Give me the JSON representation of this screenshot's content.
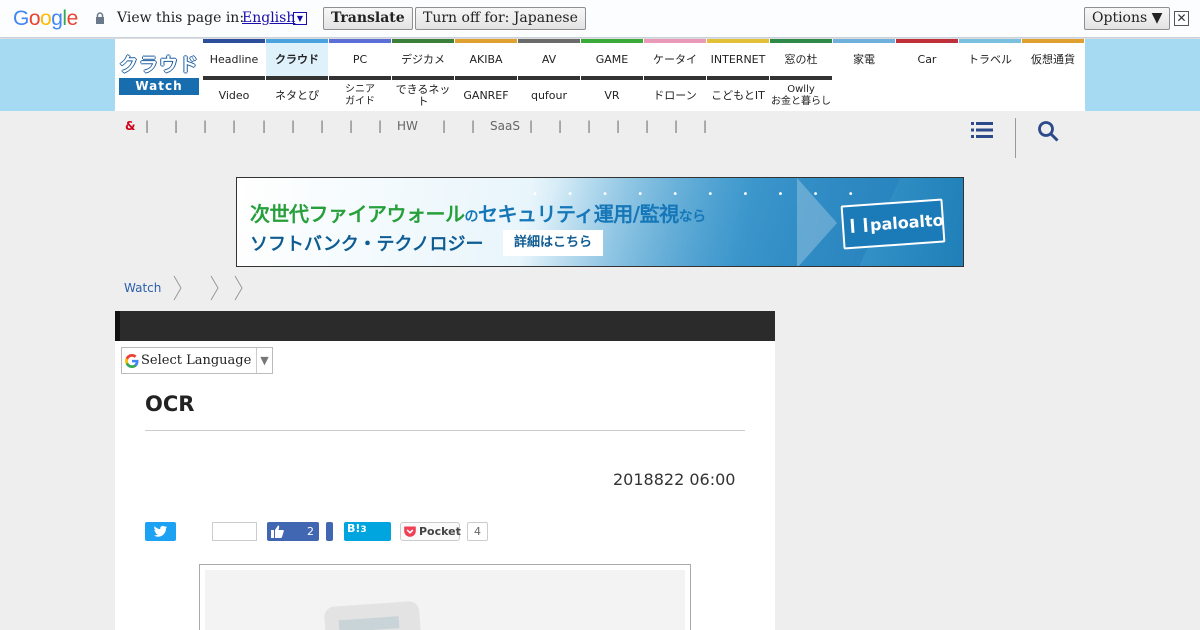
{
  "translate_bar": {
    "logo": [
      "G",
      "o",
      "o",
      "g",
      "l",
      "e"
    ],
    "view_label": "View this page in:",
    "language": "English",
    "translate_button": "Translate",
    "turn_off_button": "Turn off for: Japanese",
    "options_button": "Options ▼",
    "close": "✕"
  },
  "site": {
    "logo_top": "クラウド",
    "logo_bottom": "Watch"
  },
  "nav": {
    "row1": [
      {
        "label": "Headline",
        "color": "#2d4e9b"
      },
      {
        "label": "クラウド",
        "color": "#4aa3df",
        "active": true
      },
      {
        "label": "PC",
        "color": "#5c6fd6"
      },
      {
        "label": "デジカメ",
        "color": "#3b7f3b"
      },
      {
        "label": "AKIBA",
        "color": "#e0a030"
      },
      {
        "label": "AV",
        "color": "#6b6b6b"
      },
      {
        "label": "GAME",
        "color": "#3aaa3a"
      },
      {
        "label": "ケータイ",
        "color": "#e89ab8"
      },
      {
        "label": "INTERNET",
        "color": "#e3c03a"
      },
      {
        "label": "窓の杜",
        "color": "#2f8a4a"
      },
      {
        "label": "家電",
        "color": "#6fb0dc"
      },
      {
        "label": "Car",
        "color": "#c0303a"
      },
      {
        "label": "トラベル",
        "color": "#7cc0e0"
      },
      {
        "label": "仮想通貨",
        "color": "#e0a030"
      }
    ],
    "row2": [
      {
        "label": "Video"
      },
      {
        "label": "ネタとぴ"
      },
      {
        "label": "シニア\nガイド"
      },
      {
        "label": "できるネット"
      },
      {
        "label": "GANREF"
      },
      {
        "label": "qufour"
      },
      {
        "label": "VR"
      },
      {
        "label": "ドローン"
      },
      {
        "label": "こどもとIT"
      },
      {
        "label": "Owlly\nお金と暮らし"
      }
    ]
  },
  "subnav": {
    "amp": "&",
    "hw": "HW",
    "saas": "SaaS"
  },
  "banner": {
    "line1_a": "次世代ファイアウォール",
    "line1_b": "の",
    "line1_c": "セキュリティ運用/監視",
    "line1_d": "なら",
    "line2": "ソフトバンク・テクノロジー",
    "detail": "詳細はこちら",
    "dots": "• • • • • • • • • •",
    "brand": "paloalto"
  },
  "breadcrumb": {
    "first": "Watch"
  },
  "article": {
    "language_select": "Select Language",
    "title": "OCR",
    "date": "2018822 06:00",
    "share": {
      "like_count": "2",
      "hatena_label": "B!",
      "hatena_count": "3",
      "pocket_label": "Pocket",
      "pocket_count": "4"
    }
  }
}
